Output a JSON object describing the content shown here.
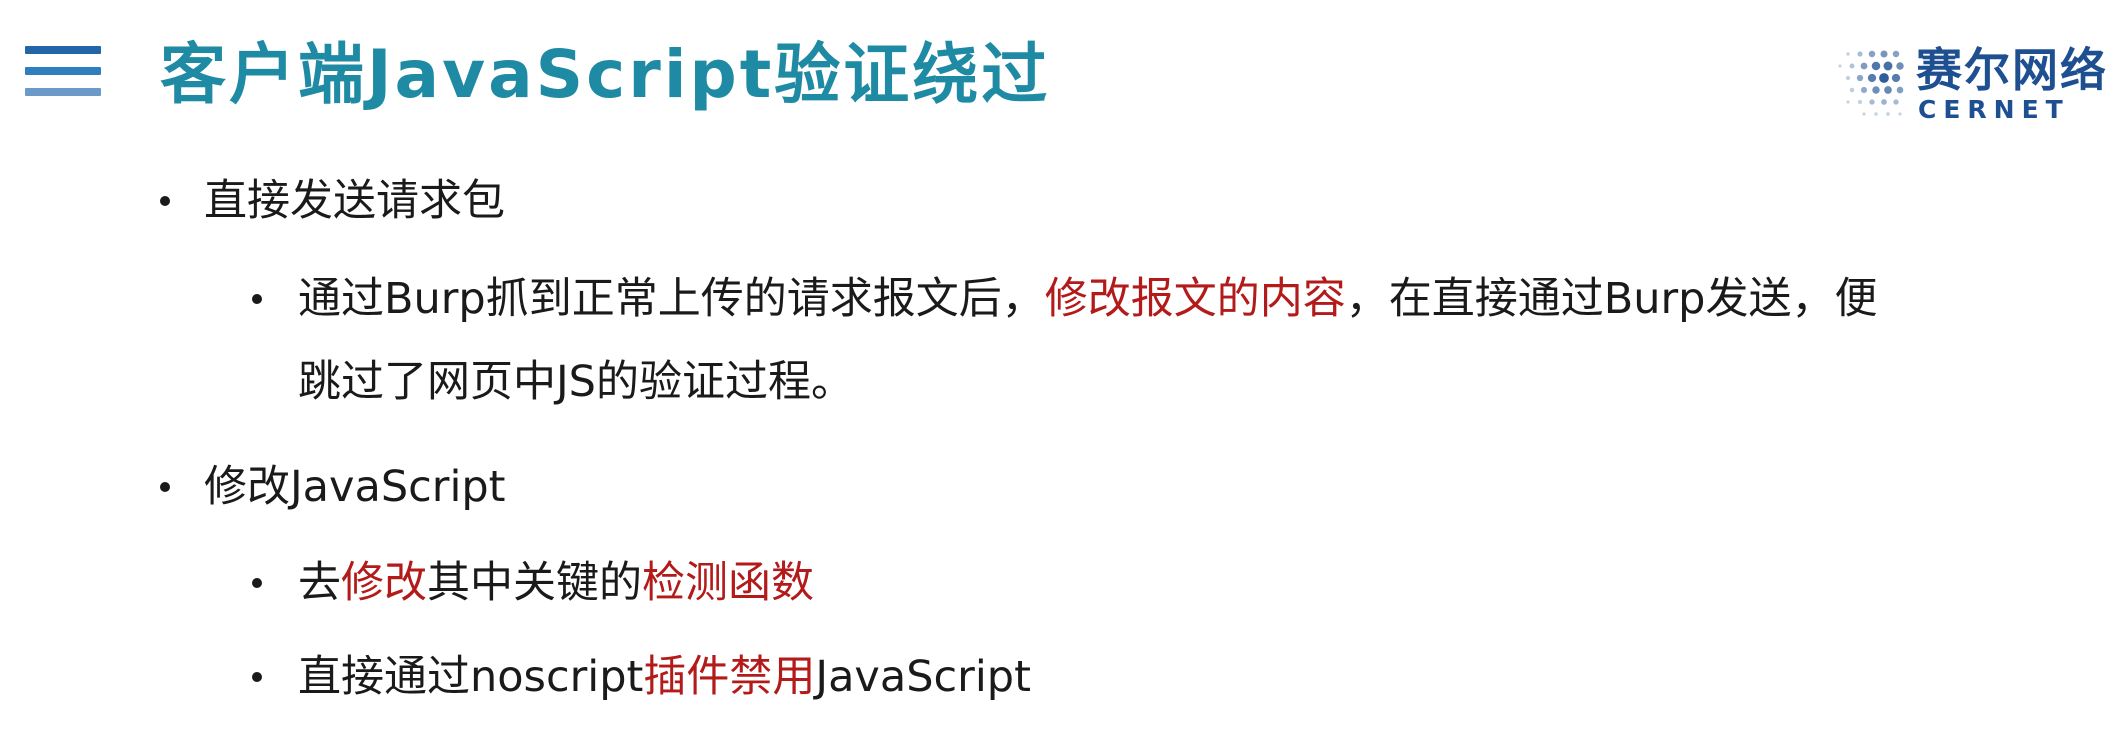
{
  "header": {
    "title": "客户端JavaScript验证绕过",
    "title_color": "#1f8aa3"
  },
  "menu_icon": {
    "icon": "menu-icon",
    "colors": [
      "#2166a8",
      "#2f7fbf",
      "#6b9ac9"
    ]
  },
  "logo": {
    "cn": "赛尔网络",
    "en": "CERNET",
    "color": "#1d4f91"
  },
  "colors": {
    "text": "#1a1a1a",
    "highlight": "#b31b1b"
  },
  "bullets": [
    {
      "level": 1,
      "segments": [
        {
          "text": "直接发送请求包",
          "highlight": false
        }
      ]
    },
    {
      "level": 2,
      "segments": [
        {
          "text": "通过Burp抓到正常上传的请求报文后，",
          "highlight": false
        },
        {
          "text": "修改报文的内容",
          "highlight": true
        },
        {
          "text": "，在直接通过Burp发送，便",
          "highlight": false
        }
      ]
    },
    {
      "level": 2,
      "continuation": true,
      "segments": [
        {
          "text": "跳过了网页中JS的验证过程。",
          "highlight": false
        }
      ]
    },
    {
      "level": 1,
      "segments": [
        {
          "text": "修改JavaScript",
          "highlight": false
        }
      ]
    },
    {
      "level": 2,
      "segments": [
        {
          "text": "去",
          "highlight": false
        },
        {
          "text": "修改",
          "highlight": true
        },
        {
          "text": "其中关键的",
          "highlight": false
        },
        {
          "text": "检测函数",
          "highlight": true
        }
      ]
    },
    {
      "level": 2,
      "segments": [
        {
          "text": "直接通过noscript",
          "highlight": false
        },
        {
          "text": "插件禁用",
          "highlight": true
        },
        {
          "text": "JavaScript",
          "highlight": false
        }
      ]
    }
  ]
}
